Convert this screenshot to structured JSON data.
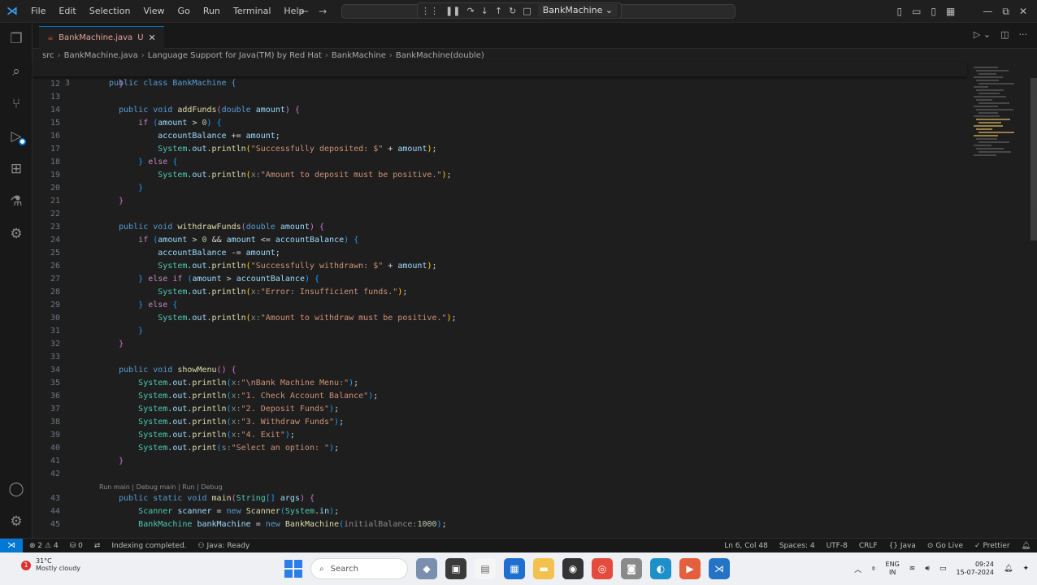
{
  "titlebar": {
    "menu": [
      "File",
      "Edit",
      "Selection",
      "View",
      "Go",
      "Run",
      "Terminal",
      "Help"
    ],
    "debug_target": "BankMachine"
  },
  "tab": {
    "label": "BankMachine.java",
    "modified_marker": "U"
  },
  "breadcrumb": {
    "items": [
      "src",
      "BankMachine.java",
      "Language Support for Java(TM) by Red Hat",
      "BankMachine",
      "BankMachine(double)"
    ]
  },
  "sticky": {
    "num": "3",
    "code": "public class BankMachine {"
  },
  "code_lines": [
    {
      "num": "12",
      "html": "    <span class='br2'>}</span>"
    },
    {
      "num": "13",
      "html": ""
    },
    {
      "num": "14",
      "html": "    <span class='kw'>public</span> <span class='kw'>void</span> <span class='fn'>addFunds</span><span class='br2'>(</span><span class='kw'>double</span> <span class='id'>amount</span><span class='br2'>)</span> <span class='br2'>{</span>"
    },
    {
      "num": "15",
      "html": "        <span class='ctl'>if</span> <span class='br3'>(</span><span class='id'>amount</span> <span class='pl'>&gt;</span> <span class='num'>0</span><span class='br3'>)</span> <span class='br3'>{</span>"
    },
    {
      "num": "16",
      "html": "            <span class='id'>accountBalance</span> <span class='pl'>+=</span> <span class='id'>amount</span><span class='pl'>;</span>"
    },
    {
      "num": "17",
      "html": "            <span class='ty'>System</span><span class='pl'>.</span><span class='id'>out</span><span class='pl'>.</span><span class='fn'>println</span><span class='br1'>(</span><span class='str'>\"Successfully deposited: $\"</span> <span class='pl'>+</span> <span class='id'>amount</span><span class='br1'>)</span><span class='pl'>;</span>"
    },
    {
      "num": "18",
      "html": "        <span class='br3'>}</span> <span class='ctl'>else</span> <span class='br3'>{</span>"
    },
    {
      "num": "19",
      "html": "            <span class='ty'>System</span><span class='pl'>.</span><span class='id'>out</span><span class='pl'>.</span><span class='fn'>println</span><span class='br1'>(</span><span class='hint'>x:</span><span class='str'>\"Amount to deposit must be positive.\"</span><span class='br1'>)</span><span class='pl'>;</span>"
    },
    {
      "num": "20",
      "html": "        <span class='br3'>}</span>"
    },
    {
      "num": "21",
      "html": "    <span class='br2'>}</span>"
    },
    {
      "num": "22",
      "html": ""
    },
    {
      "num": "23",
      "html": "    <span class='kw'>public</span> <span class='kw'>void</span> <span class='fn'>withdrawFunds</span><span class='br2'>(</span><span class='kw'>double</span> <span class='id'>amount</span><span class='br2'>)</span> <span class='br2'>{</span>"
    },
    {
      "num": "24",
      "html": "        <span class='ctl'>if</span> <span class='br3'>(</span><span class='id'>amount</span> <span class='pl'>&gt;</span> <span class='num'>0</span> <span class='pl'>&amp;&amp;</span> <span class='id'>amount</span> <span class='pl'>&lt;=</span> <span class='id'>accountBalance</span><span class='br3'>)</span> <span class='br3'>{</span>"
    },
    {
      "num": "25",
      "html": "            <span class='id'>accountBalance</span> <span class='pl'>-=</span> <span class='id'>amount</span><span class='pl'>;</span>"
    },
    {
      "num": "26",
      "html": "            <span class='ty'>System</span><span class='pl'>.</span><span class='id'>out</span><span class='pl'>.</span><span class='fn'>println</span><span class='br1'>(</span><span class='str'>\"Successfully withdrawn: $\"</span> <span class='pl'>+</span> <span class='id'>amount</span><span class='br1'>)</span><span class='pl'>;</span>"
    },
    {
      "num": "27",
      "html": "        <span class='br3'>}</span> <span class='ctl'>else</span> <span class='ctl'>if</span> <span class='br3'>(</span><span class='id'>amount</span> <span class='pl'>&gt;</span> <span class='id'>accountBalance</span><span class='br3'>)</span> <span class='br3'>{</span>"
    },
    {
      "num": "28",
      "html": "            <span class='ty'>System</span><span class='pl'>.</span><span class='id'>out</span><span class='pl'>.</span><span class='fn'>println</span><span class='br1'>(</span><span class='hint'>x:</span><span class='str'>\"Error: Insufficient funds.\"</span><span class='br1'>)</span><span class='pl'>;</span>"
    },
    {
      "num": "29",
      "html": "        <span class='br3'>}</span> <span class='ctl'>else</span> <span class='br3'>{</span>"
    },
    {
      "num": "30",
      "html": "            <span class='ty'>System</span><span class='pl'>.</span><span class='id'>out</span><span class='pl'>.</span><span class='fn'>println</span><span class='br1'>(</span><span class='hint'>x:</span><span class='str'>\"Amount to withdraw must be positive.\"</span><span class='br1'>)</span><span class='pl'>;</span>"
    },
    {
      "num": "31",
      "html": "        <span class='br3'>}</span>"
    },
    {
      "num": "32",
      "html": "    <span class='br2'>}</span>"
    },
    {
      "num": "33",
      "html": ""
    },
    {
      "num": "34",
      "html": "    <span class='kw'>public</span> <span class='kw'>void</span> <span class='fn'>showMenu</span><span class='br2'>()</span> <span class='br2'>{</span>"
    },
    {
      "num": "35",
      "html": "        <span class='ty'>System</span><span class='pl'>.</span><span class='id'>out</span><span class='pl'>.</span><span class='fn'>println</span><span class='br3'>(</span><span class='hint'>x:</span><span class='str'>\"\\nBank Machine Menu:\"</span><span class='br3'>)</span><span class='pl'>;</span>"
    },
    {
      "num": "36",
      "html": "        <span class='ty'>System</span><span class='pl'>.</span><span class='id'>out</span><span class='pl'>.</span><span class='fn'>println</span><span class='br3'>(</span><span class='hint'>x:</span><span class='str'>\"1. Check Account Balance\"</span><span class='br3'>)</span><span class='pl'>;</span>"
    },
    {
      "num": "37",
      "html": "        <span class='ty'>System</span><span class='pl'>.</span><span class='id'>out</span><span class='pl'>.</span><span class='fn'>println</span><span class='br3'>(</span><span class='hint'>x:</span><span class='str'>\"2. Deposit Funds\"</span><span class='br3'>)</span><span class='pl'>;</span>"
    },
    {
      "num": "38",
      "html": "        <span class='ty'>System</span><span class='pl'>.</span><span class='id'>out</span><span class='pl'>.</span><span class='fn'>println</span><span class='br3'>(</span><span class='hint'>x:</span><span class='str'>\"3. Withdraw Funds\"</span><span class='br3'>)</span><span class='pl'>;</span>"
    },
    {
      "num": "39",
      "html": "        <span class='ty'>System</span><span class='pl'>.</span><span class='id'>out</span><span class='pl'>.</span><span class='fn'>println</span><span class='br3'>(</span><span class='hint'>x:</span><span class='str'>\"4. Exit\"</span><span class='br3'>)</span><span class='pl'>;</span>"
    },
    {
      "num": "40",
      "html": "        <span class='ty'>System</span><span class='pl'>.</span><span class='id'>out</span><span class='pl'>.</span><span class='fn'>print</span><span class='br3'>(</span><span class='hint'>s:</span><span class='str'>\"Select an option: \"</span><span class='br3'>)</span><span class='pl'>;</span>"
    },
    {
      "num": "41",
      "html": "    <span class='br2'>}</span>"
    },
    {
      "num": "42",
      "html": ""
    },
    {
      "num": "43",
      "html": "    <span class='kw'>public</span> <span class='kw'>static</span> <span class='kw'>void</span> <span class='fn'>main</span><span class='br2'>(</span><span class='ty'>String</span><span class='br3'>[]</span> <span class='id'>args</span><span class='br2'>)</span> <span class='br2'>{</span>"
    },
    {
      "num": "44",
      "html": "        <span class='ty'>Scanner</span> <span class='id'>scanner</span> <span class='pl'>=</span> <span class='kw'>new</span> <span class='fn'>Scanner</span><span class='br3'>(</span><span class='ty'>System</span><span class='pl'>.</span><span class='id'>in</span><span class='br3'>)</span><span class='pl'>;</span>"
    },
    {
      "num": "45",
      "html": "        <span class='ty'>BankMachine</span> <span class='id'>bankMachine</span> <span class='pl'>=</span> <span class='kw'>new</span> <span class='fn'>BankMachine</span><span class='br3'>(</span><span class='hint'>initialBalance:</span><span class='num'>1000</span><span class='br3'>)</span><span class='pl'>;</span>"
    }
  ],
  "codelens": "Run main | Debug main | Run | Debug",
  "statusbar": {
    "errors": "2",
    "warnings": "4",
    "ports": "0",
    "indexing": "Indexing completed.",
    "java_status": "Java: Ready",
    "position": "Ln 6, Col 48",
    "spaces": "Spaces: 4",
    "encoding": "UTF-8",
    "eol": "CRLF",
    "language": "Java",
    "golive": "Go Live",
    "prettier": "Prettier"
  },
  "taskbar": {
    "weather_temp": "31°C",
    "weather_desc": "Mostly cloudy",
    "search_placeholder": "Search",
    "lang_top": "ENG",
    "lang_bottom": "IN",
    "time": "09:24",
    "date": "15-07-2024"
  },
  "colors": {
    "accent": "#0078d4",
    "editor_bg": "#1e1e1e"
  }
}
